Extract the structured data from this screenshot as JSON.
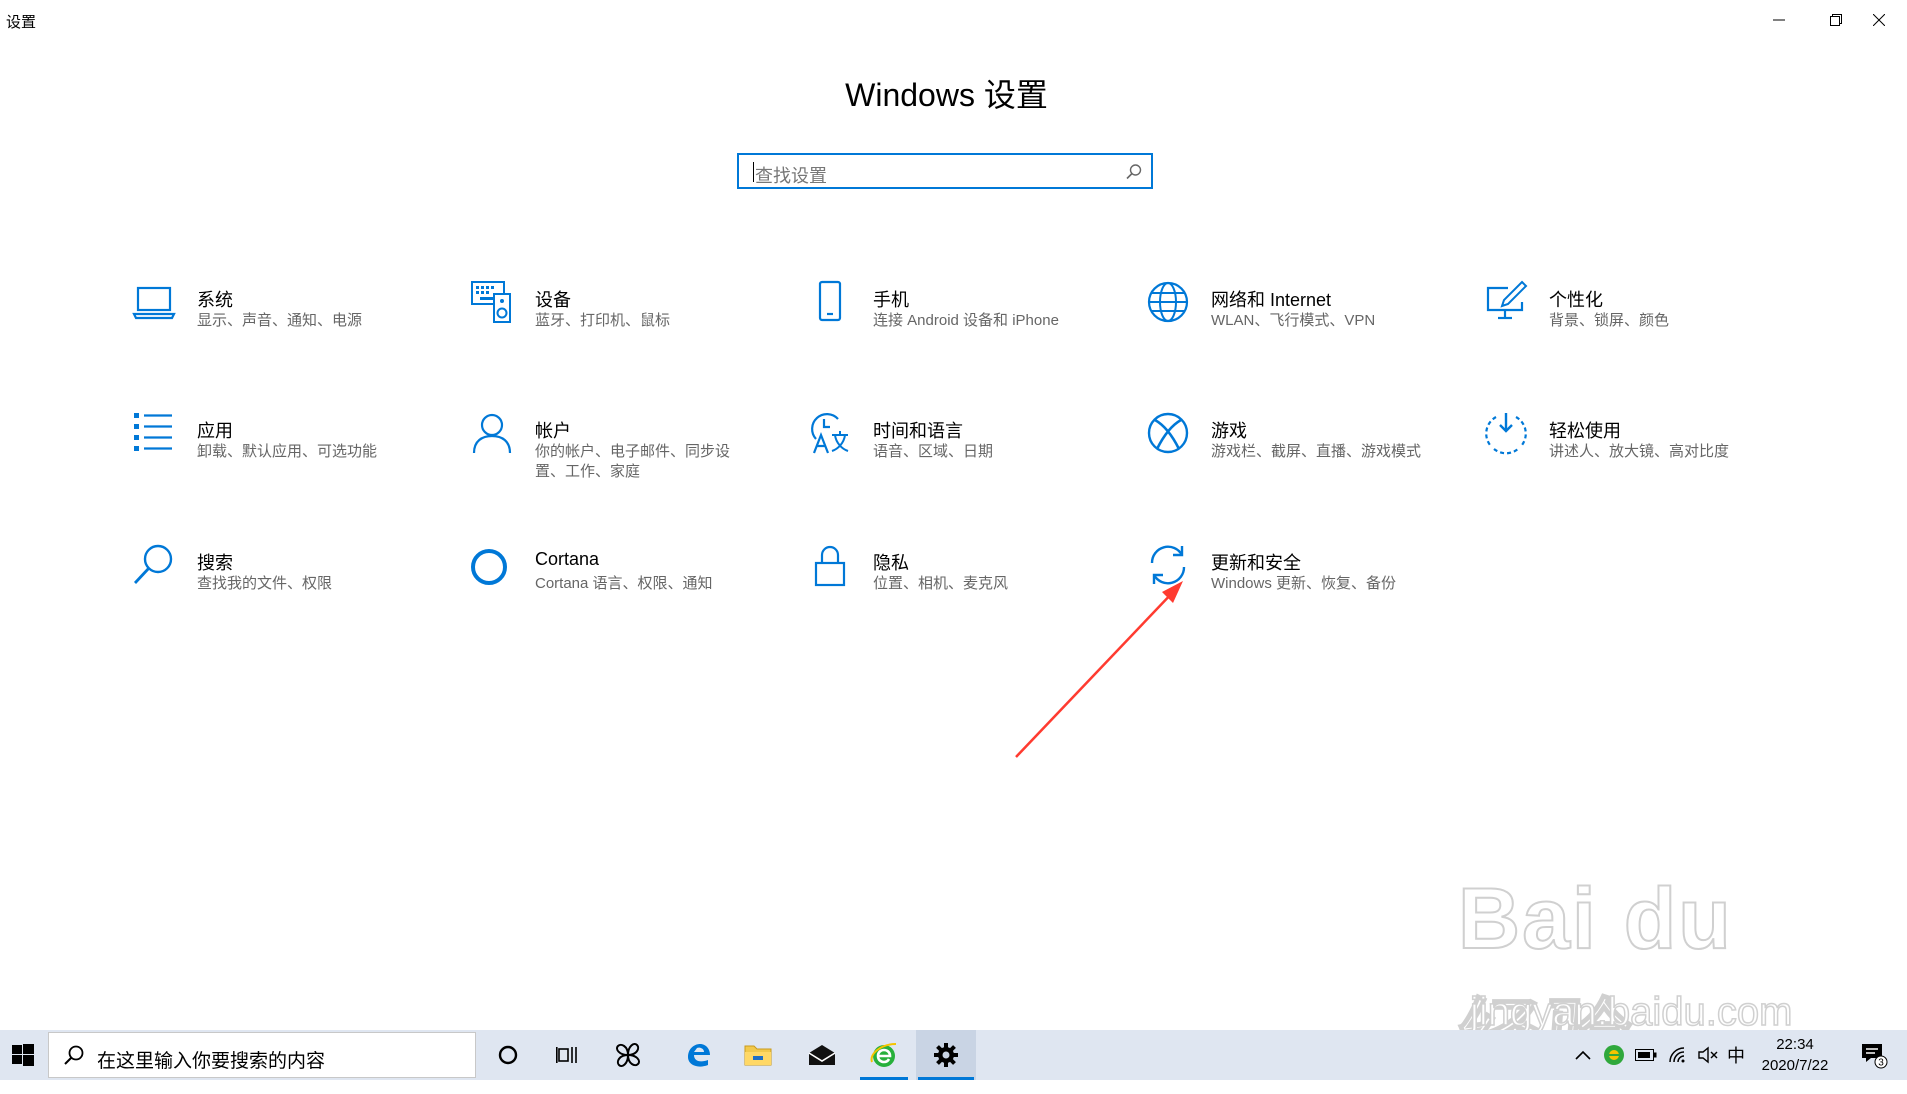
{
  "window": {
    "title": "设置",
    "heading": "Windows 设置",
    "search_placeholder": "查找设置"
  },
  "tiles": [
    {
      "title": "系统",
      "subtitle": "显示、声音、通知、电源",
      "icon": "laptop-icon"
    },
    {
      "title": "设备",
      "subtitle": "蓝牙、打印机、鼠标",
      "icon": "keyboard-speaker-icon"
    },
    {
      "title": "手机",
      "subtitle": "连接 Android 设备和 iPhone",
      "icon": "phone-icon"
    },
    {
      "title": "网络和 Internet",
      "subtitle": "WLAN、飞行模式、VPN",
      "icon": "globe-icon"
    },
    {
      "title": "个性化",
      "subtitle": "背景、锁屏、颜色",
      "icon": "paint-monitor-icon"
    },
    {
      "title": "应用",
      "subtitle": "卸载、默认应用、可选功能",
      "icon": "app-list-icon"
    },
    {
      "title": "帐户",
      "subtitle": "你的帐户、电子邮件、同步设置、工作、家庭",
      "icon": "person-icon"
    },
    {
      "title": "时间和语言",
      "subtitle": "语音、区域、日期",
      "icon": "time-language-icon"
    },
    {
      "title": "游戏",
      "subtitle": "游戏栏、截屏、直播、游戏模式",
      "icon": "xbox-icon"
    },
    {
      "title": "轻松使用",
      "subtitle": "讲述人、放大镜、高对比度",
      "icon": "ease-of-access-icon"
    },
    {
      "title": "搜索",
      "subtitle": "查找我的文件、权限",
      "icon": "search-icon"
    },
    {
      "title": "Cortana",
      "subtitle": "Cortana 语言、权限、通知",
      "icon": "cortana-icon"
    },
    {
      "title": "隐私",
      "subtitle": "位置、相机、麦克风",
      "icon": "lock-icon"
    },
    {
      "title": "更新和安全",
      "subtitle": "Windows 更新、恢复、备份",
      "icon": "update-sync-icon"
    }
  ],
  "taskbar": {
    "search_placeholder": "在这里输入你要搜索的内容",
    "ime": "中",
    "time": "22:34",
    "date": "2020/7/22",
    "notification_count": "3"
  },
  "watermark": {
    "logo": "Bai du 经验",
    "url": "jingyan.baidu.com"
  },
  "colors": {
    "accent": "#0078d7",
    "annotation_arrow": "#ff3b30",
    "taskbar_bg": "#dfe6f1"
  }
}
